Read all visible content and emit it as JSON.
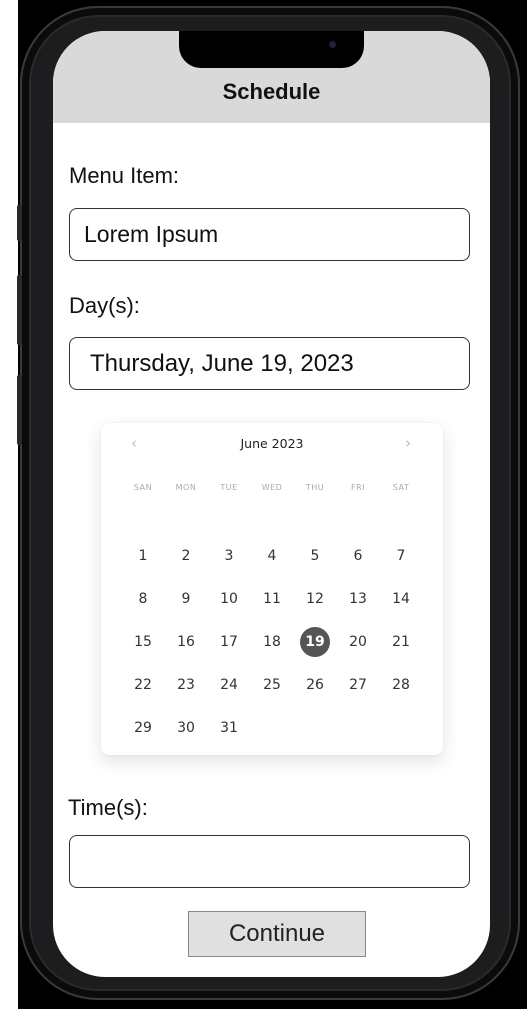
{
  "header": {
    "title": "Schedule"
  },
  "menu_item": {
    "label": "Menu Item:",
    "value": "Lorem Ipsum"
  },
  "days": {
    "label": "Day(s):",
    "value": "Thursday, June 19, 2023"
  },
  "calendar": {
    "month_label": "June 2023",
    "prev_label": "‹",
    "next_label": "›",
    "weekdays": [
      "SAN",
      "MON",
      "TUE",
      "WED",
      "THU",
      "FRI",
      "SAT"
    ],
    "days": [
      "1",
      "2",
      "3",
      "4",
      "5",
      "6",
      "7",
      "8",
      "9",
      "10",
      "11",
      "12",
      "13",
      "14",
      "15",
      "16",
      "17",
      "18",
      "19",
      "20",
      "21",
      "22",
      "23",
      "24",
      "25",
      "26",
      "27",
      "28",
      "29",
      "30",
      "31"
    ],
    "selected_day": "19"
  },
  "times": {
    "label": "Time(s):",
    "value": ""
  },
  "continue_label": "Continue",
  "colors": {
    "header_bg": "#d9d9d9",
    "selected_day_bg": "#555555"
  }
}
